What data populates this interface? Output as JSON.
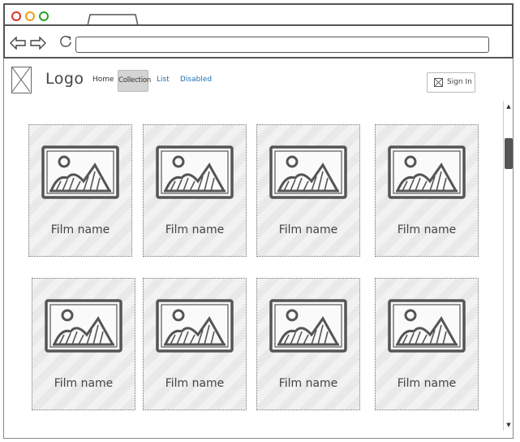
{
  "browser": {
    "url": ""
  },
  "header": {
    "logo": "Logo",
    "nav": {
      "home": "Home",
      "collection": "Collection",
      "list": "List",
      "disabled": "Disabled"
    },
    "sign_in": "Sign In"
  },
  "cards": [
    {
      "title": "Film name"
    },
    {
      "title": "Film name"
    },
    {
      "title": "Film name"
    },
    {
      "title": "Film name"
    },
    {
      "title": "Film name"
    },
    {
      "title": "Film name"
    },
    {
      "title": "Film name"
    },
    {
      "title": "Film name"
    }
  ],
  "colors": {
    "link": "#1e6fb0",
    "active_nav_bg": "#d4d4d4",
    "close_dot": "#d9342b",
    "minimize_dot": "#e8a11a",
    "maximize_dot": "#2aa12a"
  }
}
